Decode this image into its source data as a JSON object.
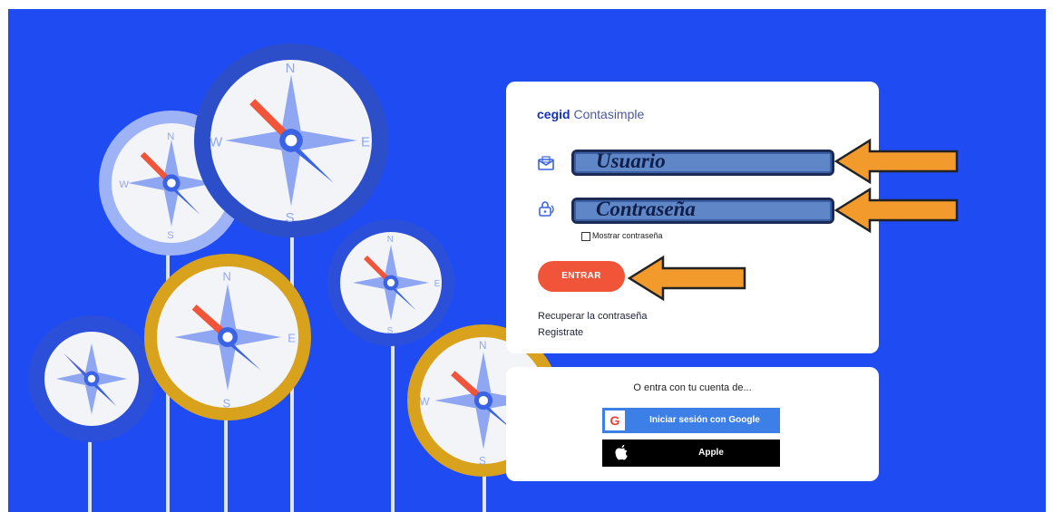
{
  "brand": {
    "bold": "cegid",
    "rest": " Contasimple"
  },
  "login": {
    "username_label": "Usuario",
    "password_label": "Contraseña",
    "show_password": "Mostrar contraseña",
    "submit": "ENTRAR",
    "recover": "Recuperar la contraseña",
    "register": "Registrate"
  },
  "social": {
    "title": "O entra con tu cuenta de...",
    "google_icon": "G",
    "google_label": "Iniciar sesión con Google",
    "apple_label": "Apple"
  },
  "compass_letters": {
    "n": "N",
    "s": "S",
    "e": "E",
    "w": "W"
  },
  "icons": [
    "envelope-icon",
    "padlock-icon",
    "google-icon",
    "apple-icon",
    "arrow-left-icon"
  ],
  "colors": {
    "background": "#1f4cf2",
    "accent_button": "#f0553a",
    "google_button": "#3c7fe6",
    "apple_button": "#000000",
    "arrow": "#f39a2c"
  }
}
